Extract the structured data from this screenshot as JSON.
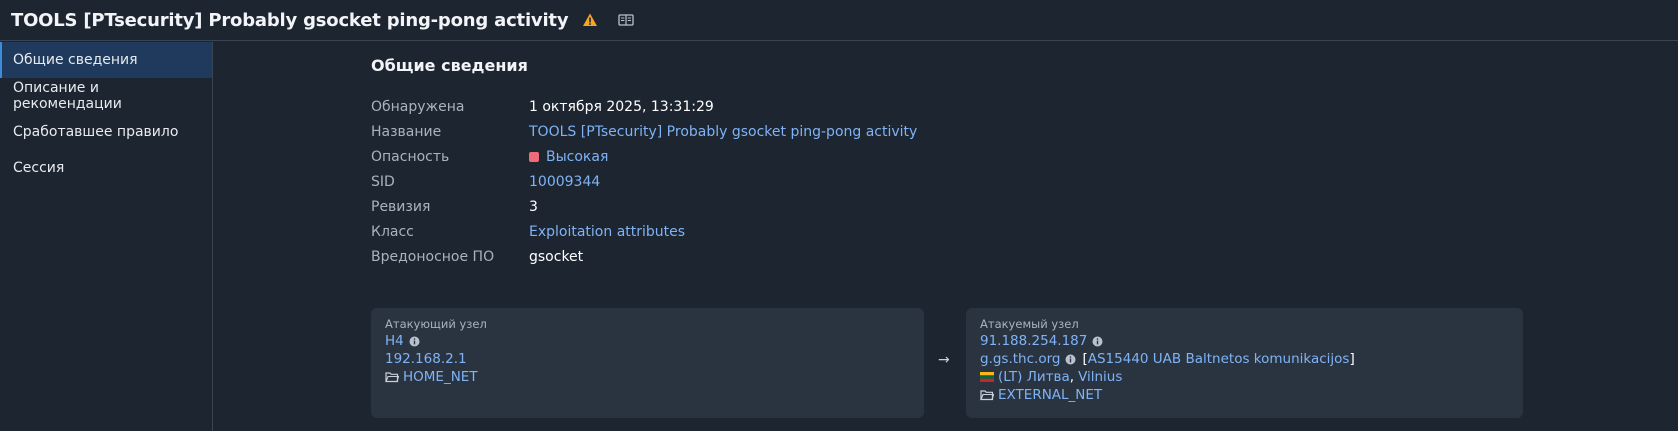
{
  "header": {
    "title": "TOOLS [PTsecurity] Probably gsocket ping-pong activity",
    "icons": [
      "warning-icon",
      "book-icon"
    ],
    "warning_color": "#f5a623"
  },
  "sidebar": {
    "items": [
      {
        "label": "Общие сведения",
        "active": true
      },
      {
        "label": "Описание и рекомендации",
        "active": false
      },
      {
        "label": "Сработавшее правило",
        "active": false
      },
      {
        "label": "Сессия",
        "active": false
      }
    ]
  },
  "main": {
    "section_title": "Общие сведения",
    "properties": {
      "detected": {
        "label": "Обнаружена",
        "value": "1 октября 2025, 13:31:29"
      },
      "name": {
        "label": "Название",
        "value": "TOOLS [PTsecurity] Probably gsocket ping-pong activity"
      },
      "severity": {
        "label": "Опасность",
        "value": "Высокая",
        "color": "#ef6b7a"
      },
      "sid": {
        "label": "SID",
        "value": "10009344"
      },
      "revision": {
        "label": "Ревизия",
        "value": "3"
      },
      "class": {
        "label": "Класс",
        "value": "Exploitation attributes"
      },
      "malware": {
        "label": "Вредоносное ПО",
        "value": "gsocket"
      }
    },
    "attacker": {
      "label": "Атакующий узел",
      "host": "H4",
      "ip": "192.168.2.1",
      "network": "HOME_NET"
    },
    "arrow": "→",
    "target": {
      "label": "Атакуемый узел",
      "ip": "91.188.254.187",
      "domain": "g.gs.thc.org",
      "as_open": "[",
      "as_info": "AS15440 UAB Baltnetos komunikacijos",
      "as_close": "]",
      "country": "(LT) Литва",
      "separator": ",",
      "city": "Vilnius",
      "network": "EXTERNAL_NET"
    }
  }
}
